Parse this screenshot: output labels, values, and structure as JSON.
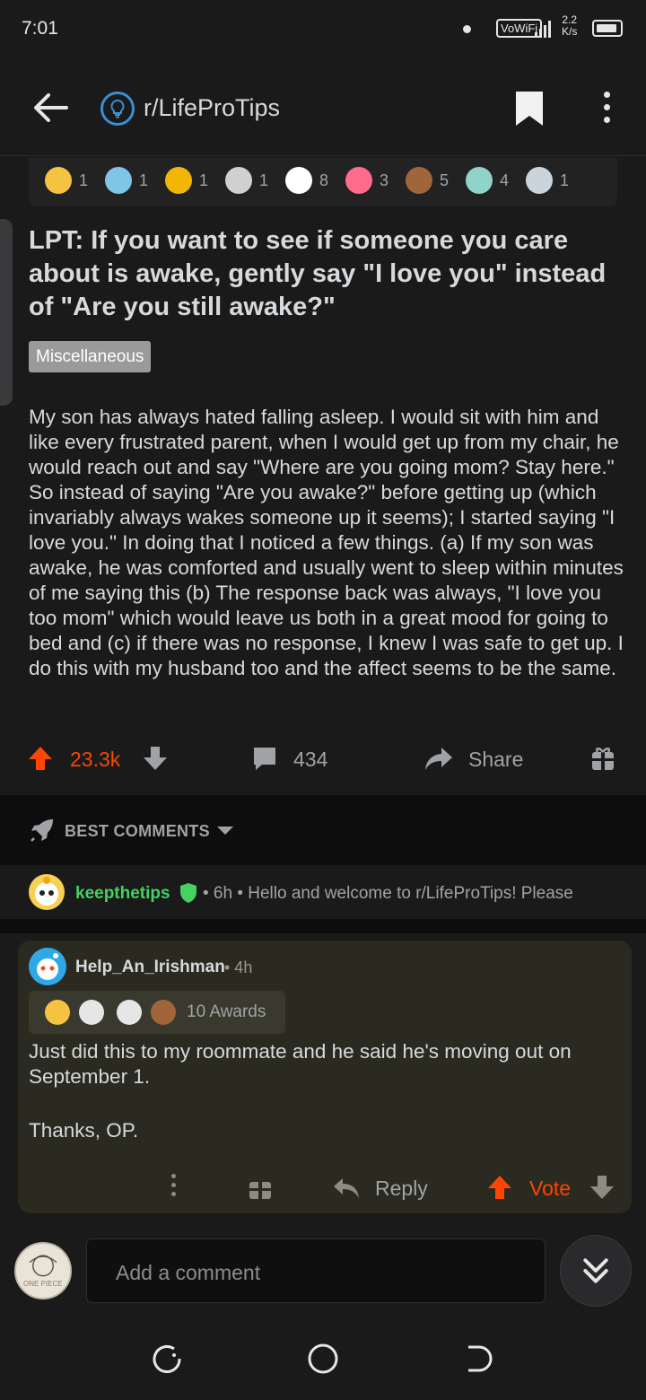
{
  "status_bar": {
    "time": "7:01",
    "network_label": "VoWiFi",
    "speed_value": "2.2",
    "speed_unit": "K/s"
  },
  "header": {
    "subreddit": "r/LifeProTips"
  },
  "post": {
    "awards": [
      {
        "icon": "award-gold-icon",
        "count": "1",
        "color": "#f5c242"
      },
      {
        "icon": "award-wholesome-icon",
        "count": "1",
        "color": "#7fc6e6"
      },
      {
        "icon": "award-helpful-icon",
        "count": "1",
        "color": "#f2b705"
      },
      {
        "icon": "award-clap-icon",
        "count": "1",
        "color": "#d0d0d0"
      },
      {
        "icon": "award-blush-icon",
        "count": "8",
        "color": "#ffffff"
      },
      {
        "icon": "award-heart-icon",
        "count": "3",
        "color": "#ff6b8a"
      },
      {
        "icon": "award-bear-icon",
        "count": "5",
        "color": "#a0653a"
      },
      {
        "icon": "award-angel-icon",
        "count": "4",
        "color": "#8fd3c9"
      },
      {
        "icon": "award-cat-icon",
        "count": "1",
        "color": "#c9d4dc"
      }
    ],
    "title": "LPT: If you want to see if someone you care about is awake, gently say \"I love you\" instead of \"Are you still awake?\"",
    "flair": "Miscellaneous",
    "body": "My son has always hated falling asleep. I would sit with him and like every frustrated parent, when I would get up from my chair, he would reach out and say \"Where are you going mom? Stay here.\" So instead of saying \"Are you awake?\" before getting up (which invariably always wakes someone up it seems); I started saying \"I love you.\" In doing that I noticed a few things. (a) If my son was awake, he was comforted and usually went to sleep within minutes of me saying this (b) The response back was always, \"I love you too mom\" which would leave us both in a great mood for going to bed and (c) if there was no response, I knew I was safe to get up. I do this with my husband too and the affect seems to be the same.",
    "score": "23.3k",
    "comments": "434",
    "share_label": "Share"
  },
  "sort": {
    "label": "BEST COMMENTS"
  },
  "pinned_comment": {
    "user": "keepthetips",
    "meta": "• 6h • Hello and welcome to r/LifeProTips! Please"
  },
  "comment": {
    "user": "Help_An_Irishman",
    "time": "• 4h",
    "awards_label": "10 Awards",
    "award_colors": [
      "#f5c242",
      "#e6e6e6",
      "#e6e6e6",
      "#a0653a"
    ],
    "text_line1": "Just did this to my roommate and he said he's moving out on September 1.",
    "text_line2": "Thanks, OP.",
    "reply_label": "Reply",
    "vote_label": "Vote"
  },
  "composer": {
    "placeholder": "Add a comment",
    "avatar_text": "ONE PIECE"
  },
  "colors": {
    "upvote": "#ff4500",
    "mod_green": "#46d160",
    "background": "#1a1a1b",
    "highlight": "#2b2a20"
  }
}
